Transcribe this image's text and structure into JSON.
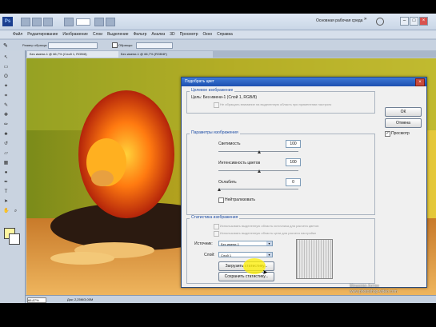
{
  "titlebar": {
    "workspace_label": "Основная рабочая среда",
    "logo_text": "Ps"
  },
  "menu": [
    "Файл",
    "Редактирование",
    "Изображение",
    "Слои",
    "Выделение",
    "Фильтр",
    "Анализ",
    "3D",
    "Просмотр",
    "Окно",
    "Справка"
  ],
  "options_bar": {
    "sample_label": "Размер образца:",
    "samples_label": "Образцы:"
  },
  "tabs": [
    {
      "label": "Без имени-1 @ 66,7% (Слой 1, RGB/8)"
    },
    {
      "label": "Без имени-1 @ 66,7% (RGB/8*)"
    }
  ],
  "status": {
    "zoom": "66,67%",
    "doc_info": "Док: 2,25М/3,00М"
  },
  "dialog": {
    "title": "Подобрать цвет",
    "target_legend": "Целевое изображение",
    "target_line": "Цель: Без имени-1 (Слой 1, RGB/8)",
    "ignore_selection": "Не обращать внимание на выделенную область при применении настроек",
    "options_legend": "Параметры изображения",
    "luminance_label": "Светимость",
    "luminance_value": "100",
    "intensity_label": "Интенсивность цветов",
    "intensity_value": "100",
    "fade_label": "Ослабить",
    "fade_value": "0",
    "neutralize_label": "Нейтрализовать",
    "stats_legend": "Статистика изображения",
    "use_selection_source": "Использовать выделенную область источника для расчета цветов",
    "use_selection_target": "Использовать выделенную область цели для расчета настройки",
    "source_label": "Источник:",
    "source_value": "Без имени-1",
    "layer_label": "Слой:",
    "layer_value": "Слой 1",
    "load_button": "Загрузить статистику...",
    "save_button": "Сохранить статистику...",
    "ok_button": "ОК",
    "cancel_button": "Отмена",
    "preview_label": "Просмотр",
    "preview_checked": true
  },
  "watermark": {
    "line1": "Мешкова Антон",
    "line2": "www.photoshop-video.com"
  },
  "colors": {
    "foreground": "#fff6a0",
    "background": "#ffffff",
    "accent": "#1f4ea6"
  }
}
